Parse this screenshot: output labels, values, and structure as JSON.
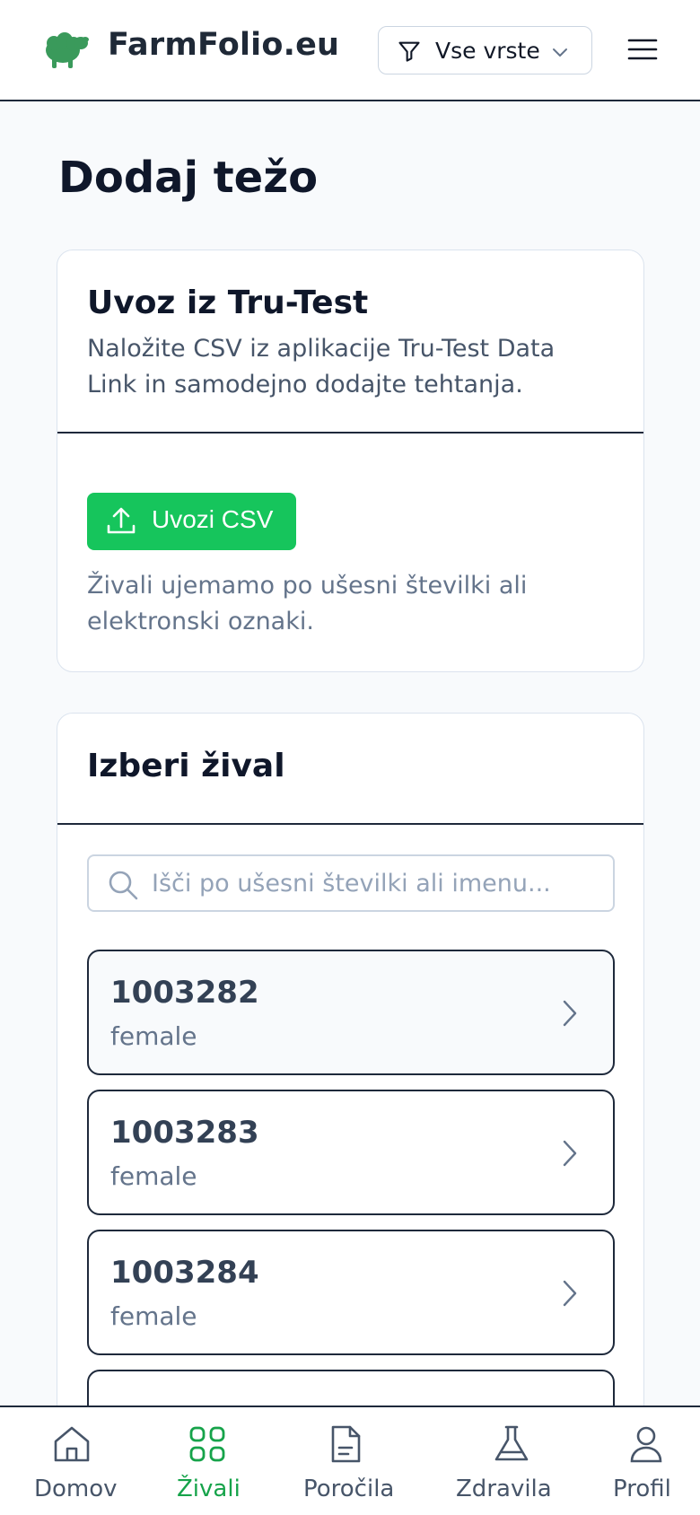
{
  "header": {
    "brand": "FarmFolio.eu",
    "filter_label": "Vse vrste"
  },
  "page": {
    "title": "Dodaj težo"
  },
  "import_card": {
    "title": "Uvoz iz Tru-Test",
    "description": "Naložite CSV iz aplikacije Tru-Test Data Link in samodejno dodajte tehtanja.",
    "button_label": "Uvozi CSV",
    "note": "Živali ujemamo po ušesni številki ali elektronski oznaki."
  },
  "select_card": {
    "title": "Izberi žival",
    "search_placeholder": "Išči po ušesni številki ali imenu...",
    "animals": [
      {
        "id": "1003282",
        "sex": "female"
      },
      {
        "id": "1003283",
        "sex": "female"
      },
      {
        "id": "1003284",
        "sex": "female"
      }
    ]
  },
  "bottom_nav": {
    "items": [
      {
        "label": "Domov",
        "icon": "home-icon"
      },
      {
        "label": "Živali",
        "icon": "grid-icon",
        "active": true
      },
      {
        "label": "Poročila",
        "icon": "document-icon"
      },
      {
        "label": "Zdravila",
        "icon": "flask-icon"
      },
      {
        "label": "Profil",
        "icon": "user-icon"
      }
    ]
  },
  "colors": {
    "accent_green": "#16c55c",
    "active_nav": "#16a34a",
    "logo_green": "#3a9a5b"
  }
}
